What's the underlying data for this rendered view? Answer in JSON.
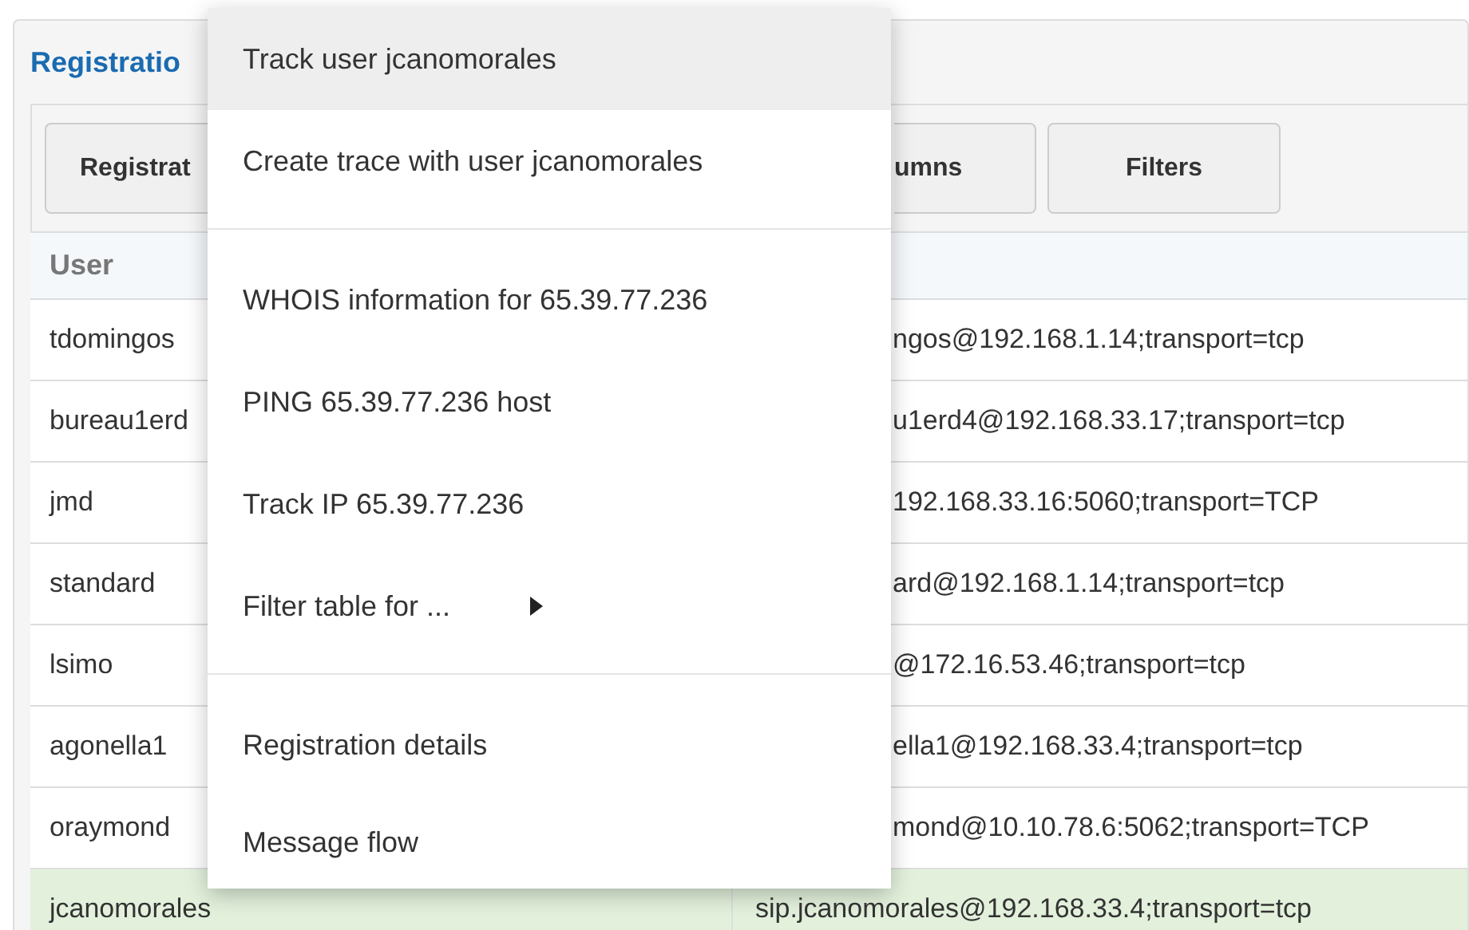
{
  "panel": {
    "title": "Registratio"
  },
  "toolbar": {
    "buttons": [
      "Registrat",
      "umns",
      "Filters"
    ]
  },
  "table": {
    "columns": [
      "User"
    ],
    "rows": [
      {
        "user": "tdomingos",
        "contact": "ngos@192.168.1.14;transport=tcp",
        "selected": false
      },
      {
        "user": "bureau1erd",
        "contact": "u1erd4@192.168.33.17;transport=tcp",
        "selected": false
      },
      {
        "user": "jmd",
        "contact": "192.168.33.16:5060;transport=TCP",
        "selected": false
      },
      {
        "user": "standard",
        "contact": "ard@192.168.1.14;transport=tcp",
        "selected": false
      },
      {
        "user": "lsimo",
        "contact": "@172.16.53.46;transport=tcp",
        "selected": false
      },
      {
        "user": "agonella1",
        "contact": "ella1@192.168.33.4;transport=tcp",
        "selected": false
      },
      {
        "user": "oraymond",
        "contact": "mond@10.10.78.6:5062;transport=TCP",
        "selected": false
      },
      {
        "user": "jcanomorales",
        "contact": "sip.jcanomorales@192.168.33.4;transport=tcp",
        "selected": true
      }
    ]
  },
  "context_menu": {
    "groups": [
      [
        {
          "label": "Track user jcanomorales",
          "kind": "action",
          "highlighted": true
        },
        {
          "label": "Create trace with user jcanomorales",
          "kind": "action",
          "highlighted": false
        }
      ],
      [
        {
          "label": "WHOIS information for 65.39.77.236",
          "kind": "action",
          "highlighted": false
        },
        {
          "label": "PING 65.39.77.236 host",
          "kind": "action",
          "highlighted": false
        },
        {
          "label": "Track IP 65.39.77.236",
          "kind": "action",
          "highlighted": false
        },
        {
          "label": "Filter table for ...",
          "kind": "submenu",
          "highlighted": false
        }
      ],
      [
        {
          "label": "Registration details",
          "kind": "action",
          "highlighted": false
        },
        {
          "label": "Message flow",
          "kind": "action",
          "highlighted": false
        }
      ]
    ]
  }
}
